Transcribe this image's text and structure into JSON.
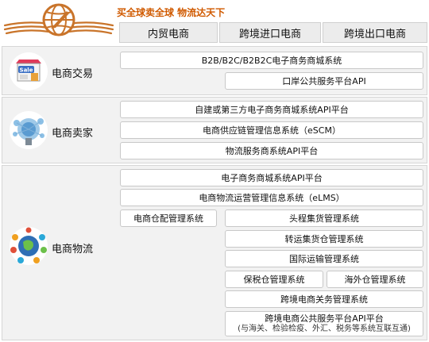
{
  "header": {
    "slogan": "买全球卖全球  物流达天下",
    "columns": [
      "内贸电商",
      "跨境进口电商",
      "跨境出口电商"
    ]
  },
  "sections": [
    {
      "label": "电商交易",
      "icon": "sale-shop-icon"
    },
    {
      "label": "电商卖家",
      "icon": "seller-cloud-icon"
    },
    {
      "label": "电商物流",
      "icon": "logistics-globe-icon"
    }
  ],
  "systems": {
    "b2b": "B2B/B2C/B2B2C电子商务商城系统",
    "port_api": "口岸公共服务平台API",
    "self_api": "自建或第三方电子商务商城系统API平台",
    "escm": "电商供应链管理信息系统（eSCM）",
    "logistics_api": "物流服务商系统API平台",
    "ecom_api": "电子商务商城系统API平台",
    "elms": "电商物流运营管理信息系统（eLMS）",
    "warehouse": "电商仓配管理系统",
    "first_leg": "头程集货管理系统",
    "transship": "转运集货仓管理系统",
    "intl_transport": "国际运输管理系统",
    "bonded": "保税仓管理系统",
    "overseas": "海外仓管理系统",
    "customs": "跨境电商关务管理系统",
    "public_api": "跨境电商公共服务平台API平台",
    "public_api_note": "(与海关、检验检疫、外汇、税务等系统互联互通)"
  }
}
